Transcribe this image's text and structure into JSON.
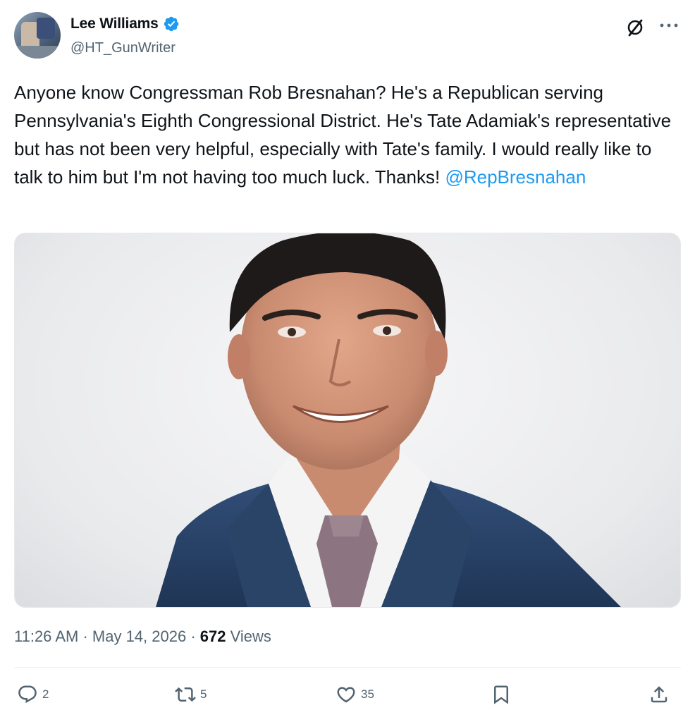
{
  "author": {
    "name": "Lee Williams",
    "handle": "@HT_GunWriter"
  },
  "tweet": {
    "text": "Anyone know Congressman Rob Bresnahan? He's a Republican serving Pennsylvania's Eighth Congressional District. He's Tate Adamiak's representative but has not been very helpful, especially with Tate's family. I would really like to talk to him but I'm not having too much luck. Thanks! ",
    "mention": "@RepBresnahan"
  },
  "meta": {
    "time": "11:26 AM",
    "sep1": " · ",
    "date": "May 14, 2026",
    "sep2": " · ",
    "views_count": "672",
    "views_label": " Views"
  },
  "actions": {
    "replies": "2",
    "reposts": "5",
    "likes": "35"
  },
  "colors": {
    "link": "#1d9bf0",
    "secondary_text": "#536471",
    "verified": "#1d9bf0"
  },
  "icons": [
    "grok-icon",
    "more-icon",
    "verified-badge-icon",
    "reply-icon",
    "repost-icon",
    "like-icon",
    "bookmark-icon",
    "share-icon"
  ]
}
